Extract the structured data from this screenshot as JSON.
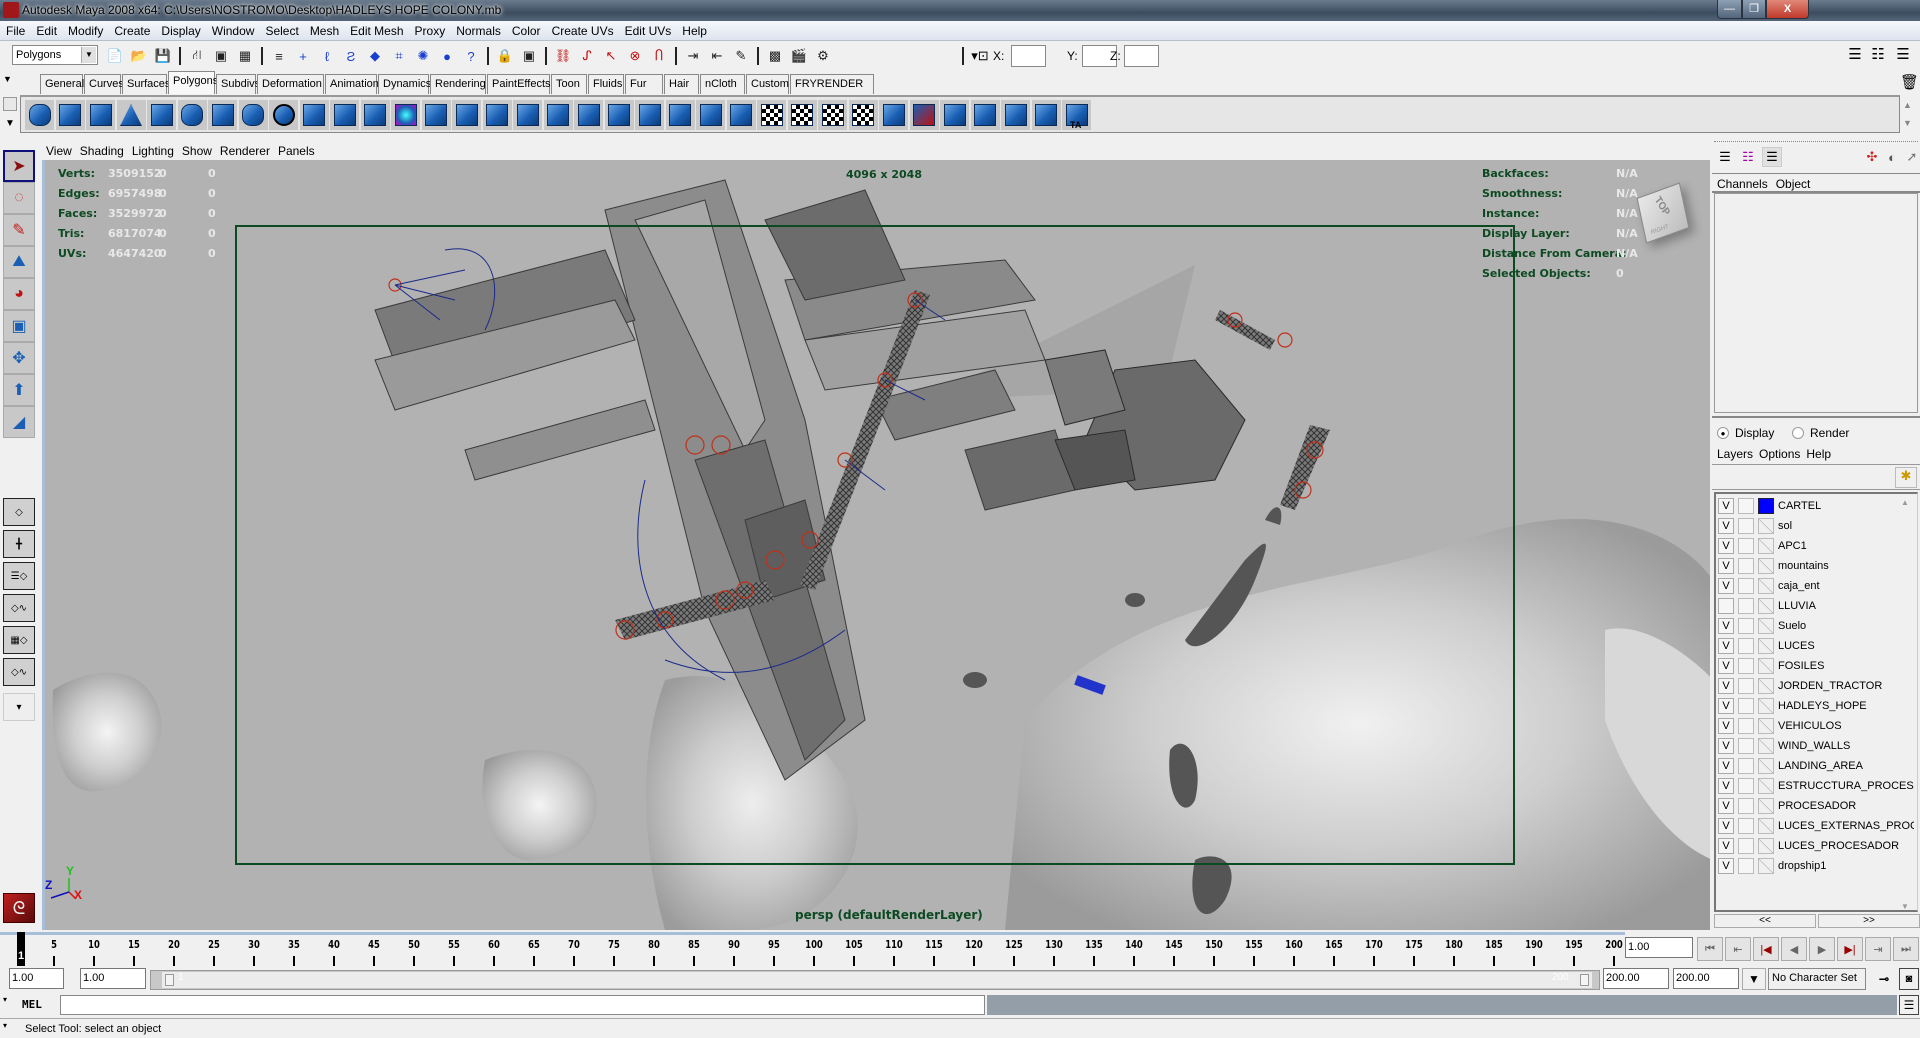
{
  "window": {
    "title": "Autodesk Maya 2008 x64: C:\\Users\\NOSTROMO\\Desktop\\HADLEYS HOPE COLONY.mb",
    "controls": {
      "minimize": "—",
      "maximize": "❐",
      "close": "X"
    }
  },
  "menubar": [
    "File",
    "Edit",
    "Modify",
    "Create",
    "Display",
    "Window",
    "Select",
    "Mesh",
    "Edit Mesh",
    "Proxy",
    "Normals",
    "Color",
    "Create UVs",
    "Edit UVs",
    "Help"
  ],
  "statusline": {
    "mode": "Polygons",
    "icons": [
      "new-scene-icon",
      "open-scene-icon",
      "save-scene-icon",
      "select-by-hierarchy-icon",
      "select-by-object-icon",
      "select-by-component-icon",
      "snap-options-icon",
      "snap-grid-icon",
      "snap-curve-icon",
      "snap-point-icon",
      "snap-view-plane-icon",
      "snap-live-icon",
      "snap-misc-icon",
      "snap-sphere-icon",
      "help-icon",
      "lock-icon",
      "select-highlight-icon",
      "history-icon",
      "construction-icon",
      "input-ops-icon",
      "output-ops-icon",
      "magnet-icon",
      "input-line-icon",
      "output-line-icon",
      "render-view-icon",
      "render-icon",
      "ipr-render-icon",
      "render-settings-icon"
    ],
    "transform_labels": {
      "x": "X:",
      "y": "Y:",
      "z": "Z:"
    },
    "transform_values": {
      "x": "",
      "y": "",
      "z": ""
    }
  },
  "shelf": {
    "tabs": [
      "General",
      "Curves",
      "Surfaces",
      "Polygons",
      "Subdivs",
      "Deformation",
      "Animation",
      "Dynamics",
      "Rendering",
      "PaintEffects",
      "Toon",
      "Fluids",
      "Fur",
      "Hair",
      "nCloth",
      "Custom",
      "FRYRENDER"
    ],
    "active_tab": "Polygons",
    "icons": [
      "poly-sphere",
      "poly-cube",
      "poly-cylinder",
      "poly-cone",
      "poly-plane",
      "poly-torus",
      "poly-prism",
      "poly-pipe",
      "select-edge-loop",
      "separate",
      "combine",
      "extract",
      "smooth-proxy",
      "extrude",
      "bridge",
      "append-to-polygon",
      "insert-edge-loop",
      "offset-edge-loop",
      "split-polygon",
      "merge",
      "collapse",
      "soften-edge",
      "harden-edge",
      "move-component",
      "planar-mapping",
      "cylindrical-mapping",
      "spherical-mapping",
      "automatic-mapping",
      "uv-texture-editor",
      "3d-paint",
      "cut-uv",
      "sew-uv",
      "move-sew",
      "split-uv",
      "texture-editor-ta"
    ],
    "last_label": "TA"
  },
  "toolbox": {
    "tools": [
      "select-tool",
      "lasso-tool",
      "paint-select-tool",
      "move-tool",
      "rotate-tool",
      "scale-tool",
      "universal-manipulator",
      "soft-modification-tool",
      "show-manipulator-tool"
    ],
    "layouts": [
      "single-perspective-layout",
      "four-view-layout",
      "outliner-persp-layout",
      "persp-graph-layout",
      "hypershade-persp-layout",
      "persp-outliner-graph-layout"
    ]
  },
  "viewport": {
    "menu": [
      "View",
      "Shading",
      "Lighting",
      "Show",
      "Renderer",
      "Panels"
    ],
    "hud_left": [
      {
        "label": "Verts:",
        "value": "3509152",
        "sel": "0",
        "tris": "0"
      },
      {
        "label": "Edges:",
        "value": "6957498",
        "sel": "0",
        "tris": "0"
      },
      {
        "label": "Faces:",
        "value": "3529972",
        "sel": "0",
        "tris": "0"
      },
      {
        "label": "Tris:",
        "value": "6817074",
        "sel": "0",
        "tris": "0"
      },
      {
        "label": "UVs:",
        "value": "4647420",
        "sel": "0",
        "tris": "0"
      }
    ],
    "hud_right": [
      {
        "label": "Backfaces:",
        "value": "N/A"
      },
      {
        "label": "Smoothness:",
        "value": "N/A"
      },
      {
        "label": "Instance:",
        "value": "N/A"
      },
      {
        "label": "Display Layer:",
        "value": "N/A"
      },
      {
        "label": "Distance From Camera:",
        "value": "N/A"
      },
      {
        "label": "Selected Objects:",
        "value": "0"
      }
    ],
    "resolution": "4096 x 2048",
    "camera_label": "persp (defaultRenderLayer)",
    "viewcube": {
      "top": "TOP",
      "side": "RIGHT"
    },
    "axis": {
      "x": "X",
      "y": "Y",
      "z": "Z"
    }
  },
  "channelbox": {
    "menu": [
      "Channels",
      "Object"
    ]
  },
  "layers": {
    "mode_options": [
      "Display",
      "Render"
    ],
    "mode_selected": "Display",
    "menu": [
      "Layers",
      "Options",
      "Help"
    ],
    "items": [
      {
        "visible": "V",
        "name": "CARTEL",
        "color": "#0000ff"
      },
      {
        "visible": "V",
        "name": "sol",
        "color": ""
      },
      {
        "visible": "V",
        "name": "APC1",
        "color": ""
      },
      {
        "visible": "V",
        "name": "mountains",
        "color": ""
      },
      {
        "visible": "V",
        "name": "caja_ent",
        "color": ""
      },
      {
        "visible": "",
        "name": "LLUVIA",
        "color": ""
      },
      {
        "visible": "V",
        "name": "Suelo",
        "color": ""
      },
      {
        "visible": "V",
        "name": "LUCES",
        "color": ""
      },
      {
        "visible": "V",
        "name": "FOSILES",
        "color": ""
      },
      {
        "visible": "V",
        "name": "JORDEN_TRACTOR",
        "color": ""
      },
      {
        "visible": "V",
        "name": "HADLEYS_HOPE",
        "color": ""
      },
      {
        "visible": "V",
        "name": "VEHICULOS",
        "color": ""
      },
      {
        "visible": "V",
        "name": "WIND_WALLS",
        "color": ""
      },
      {
        "visible": "V",
        "name": "LANDING_AREA",
        "color": ""
      },
      {
        "visible": "V",
        "name": "ESTRUCCTURA_PROCESADOR",
        "color": ""
      },
      {
        "visible": "V",
        "name": "PROCESADOR",
        "color": ""
      },
      {
        "visible": "V",
        "name": "LUCES_EXTERNAS_PROCESADOR",
        "color": ""
      },
      {
        "visible": "V",
        "name": "LUCES_PROCESADOR",
        "color": ""
      },
      {
        "visible": "V",
        "name": "dropship1",
        "color": ""
      }
    ],
    "scroll_prev": "<<",
    "scroll_next": ">>"
  },
  "timeline": {
    "current_frame": "1",
    "ticks": [
      5,
      10,
      15,
      20,
      25,
      30,
      35,
      40,
      45,
      50,
      55,
      60,
      65,
      70,
      75,
      80,
      85,
      90,
      95,
      100,
      105,
      110,
      115,
      120,
      125,
      130,
      135,
      140,
      145,
      150,
      155,
      160,
      165,
      170,
      175,
      180,
      185,
      190,
      195,
      200
    ],
    "current_time": "1.00",
    "playback": [
      "go-to-start",
      "step-back-frame",
      "step-back-key",
      "play-backwards",
      "play-forwards",
      "step-forward-key",
      "step-forward-frame",
      "go-to-end"
    ]
  },
  "range": {
    "start_time": "1.00",
    "playback_start": "1.00",
    "slider_start_label": "1",
    "slider_end_label": "200",
    "playback_end": "200.00",
    "end_time": "200.00",
    "character_set": "No Character Set"
  },
  "commandline": {
    "label": "MEL",
    "value": ""
  },
  "helpline": {
    "text": "Select Tool: select an object"
  },
  "colors": {
    "hud_green": "#0d4a22",
    "viewport_bg": "#b2b2b2",
    "layer_cartel": "#0000ff"
  }
}
